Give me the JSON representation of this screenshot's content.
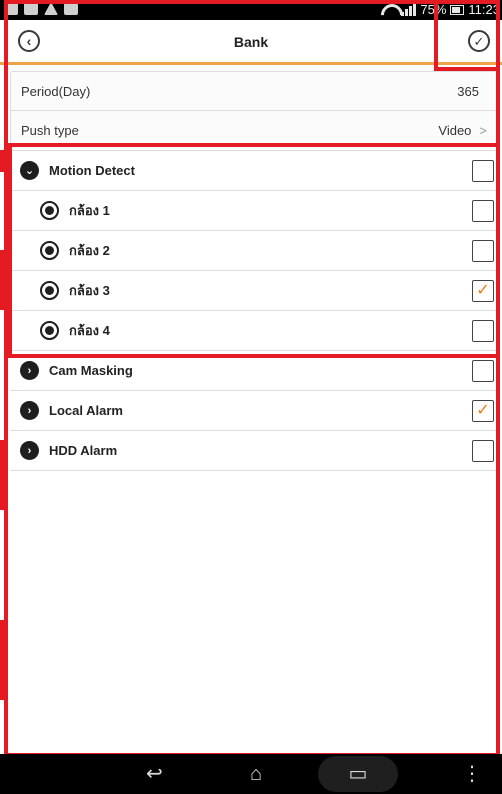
{
  "status_bar": {
    "battery_text": "75%",
    "time": "11:23",
    "left_icons": [
      "gallery-icon",
      "email-icon",
      "warning-icon",
      "store-icon"
    ]
  },
  "header": {
    "title": "Bank",
    "back_icon": "back-circle-icon",
    "confirm_icon": "check-circle-icon"
  },
  "settings": {
    "period_label": "Period(Day)",
    "period_value": "365",
    "push_type_label": "Push type",
    "push_type_value": "Video",
    "chevron": ">"
  },
  "alarms": [
    {
      "label": "Motion Detect",
      "checked": false,
      "expanded": true
    },
    {
      "label": "Cam Masking",
      "checked": false,
      "expanded": false
    },
    {
      "label": "Local Alarm",
      "checked": true,
      "expanded": false
    },
    {
      "label": "HDD Alarm",
      "checked": false,
      "expanded": false
    }
  ],
  "cameras": [
    {
      "label": "กล้อง 1",
      "checked": false
    },
    {
      "label": "กล้อง 2",
      "checked": false
    },
    {
      "label": "กล้อง 3",
      "checked": true
    },
    {
      "label": "กล้อง 4",
      "checked": false
    }
  ],
  "nav": {
    "back": "↩",
    "home": "⌂",
    "recent": "▭",
    "menu": "⋮"
  },
  "colors": {
    "accent": "#f0a24a",
    "check": "#e97a1b",
    "annotation": "#e41b23"
  }
}
